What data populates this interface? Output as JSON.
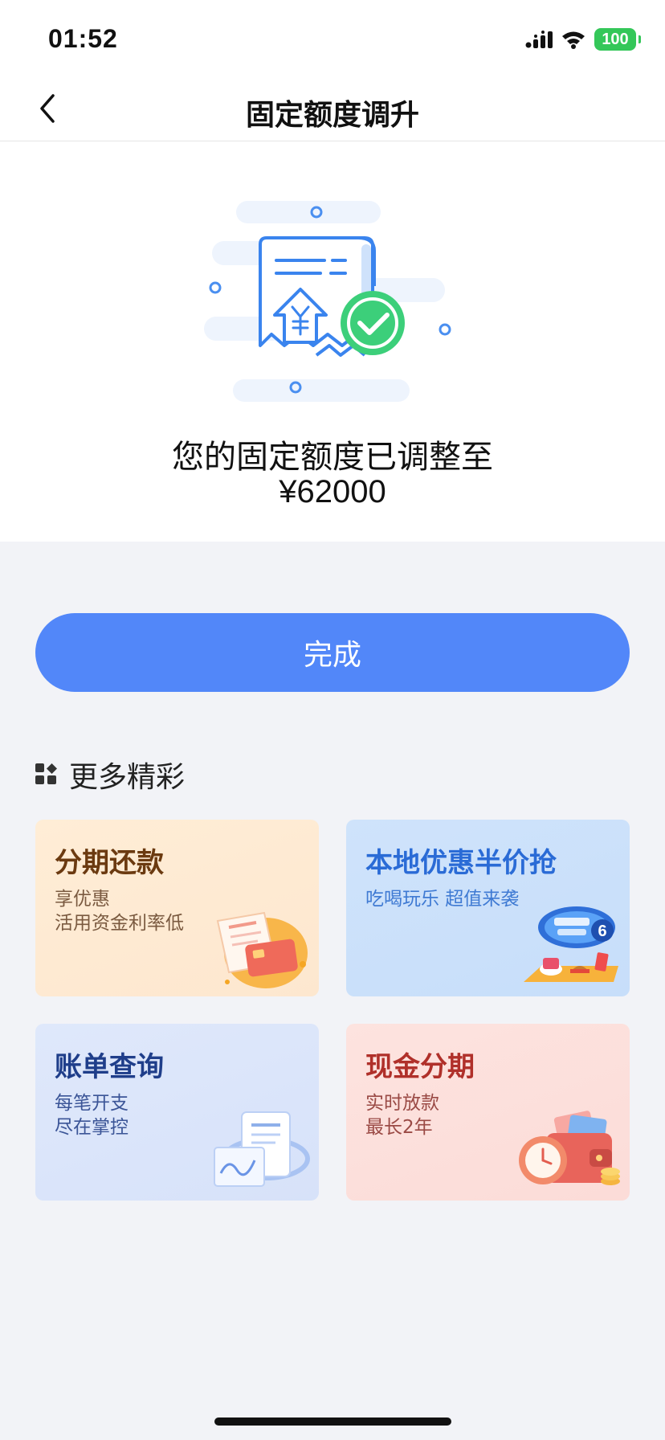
{
  "status_bar": {
    "time": "01:52",
    "battery": "100",
    "icons": [
      "signal-icon",
      "wifi-icon",
      "battery-icon"
    ]
  },
  "nav": {
    "title": "固定额度调升",
    "back_icon": "chevron-left-icon"
  },
  "result": {
    "illustration": "receipt-success-icon",
    "message": "您的固定额度已调整至",
    "amount": "¥62000"
  },
  "done_button": {
    "label": "完成"
  },
  "more": {
    "icon": "grid-apps-icon",
    "title": "更多精彩",
    "cards": [
      {
        "title": "分期还款",
        "line1": "享优惠",
        "line2": "活用资金利率低",
        "art": "bill-card-icon"
      },
      {
        "title": "本地优惠半价抢",
        "line1": "吃喝玩乐 超值来袭",
        "line2": "",
        "art": "saturday-food-icon"
      },
      {
        "title": "账单查询",
        "line1": "每笔开支",
        "line2": "尽在掌控",
        "art": "statement-chart-icon"
      },
      {
        "title": "现金分期",
        "line1": "实时放款",
        "line2": "最长2年",
        "art": "wallet-clock-icon"
      }
    ]
  },
  "colors": {
    "accent": "#5287f9",
    "success": "#3ccf7a",
    "background": "#f2f3f7"
  }
}
